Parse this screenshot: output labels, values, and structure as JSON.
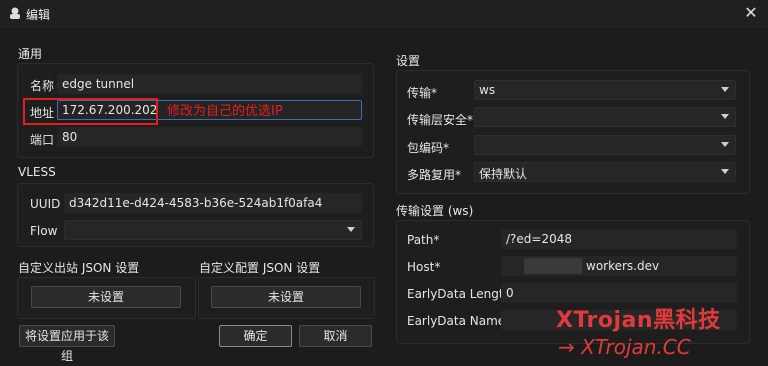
{
  "window": {
    "title": "编辑"
  },
  "general": {
    "section": "通用",
    "name_label": "名称",
    "name_value": "edge tunnel",
    "address_label": "地址",
    "address_value": "172.67.200.202",
    "annotation": "修改为自己的优选IP",
    "port_label": "端口",
    "port_value": "80"
  },
  "vless": {
    "section": "VLESS",
    "uuid_label": "UUID",
    "uuid_value": "d342d11e-d424-4583-b36e-524ab1f0afa4",
    "flow_label": "Flow",
    "flow_value": ""
  },
  "outbound_json": {
    "section": "自定义出站 JSON 设置",
    "button": "未设置"
  },
  "config_json": {
    "section": "自定义配置 JSON 设置",
    "button": "未设置"
  },
  "buttons": {
    "apply_group": "将设置应用于该组",
    "ok": "确定",
    "cancel": "取消"
  },
  "settings": {
    "section": "设置",
    "transport_label": "传输*",
    "transport_value": "ws",
    "security_label": "传输层安全*",
    "security_value": "",
    "encoding_label": "包编码*",
    "encoding_value": "",
    "mux_label": "多路复用*",
    "mux_value": "保持默认"
  },
  "transport": {
    "section": "传输设置 (ws)",
    "path_label": "Path*",
    "path_value": "/?ed=2048",
    "host_label": "Host*",
    "host_value": "workers.dev",
    "early_len_label": "EarlyData Length",
    "early_len_value": "0",
    "early_name_label": "EarlyData Name",
    "early_name_value": ""
  },
  "watermark": {
    "line1": "XTrojan黑科技",
    "line2": "→ XTrojan.CC"
  }
}
